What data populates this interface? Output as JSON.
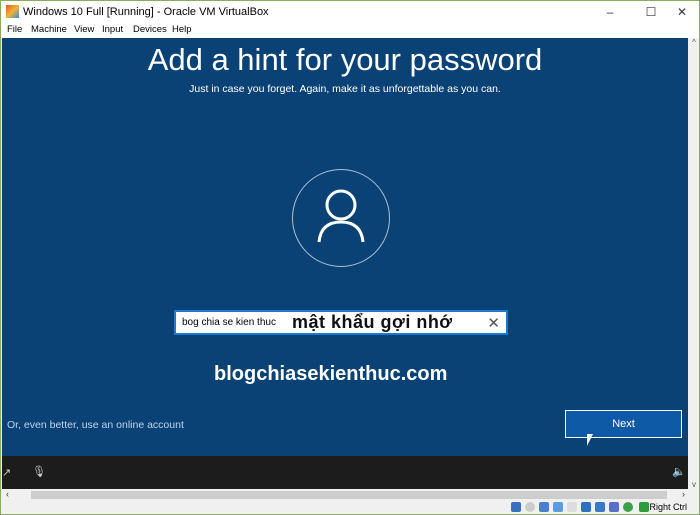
{
  "window": {
    "title": "Windows 10 Full [Running] - Oracle VM VirtualBox",
    "minimize": "–",
    "maximize": "☐",
    "close": "✕"
  },
  "menu": [
    "File",
    "Machine",
    "View",
    "Input",
    "Devices",
    "Help"
  ],
  "setup": {
    "heading": "Add a hint for your password",
    "subtitle": "Just in case you forget. Again, make it as unforgettable as you can.",
    "hint_value": "bog chia se kien thuc",
    "overlay_caption": "mật khẩu gợi nhớ",
    "clear_icon": "✕",
    "watermark": "blogchiasekienthuc.com",
    "online_link": "Or, even better, use an online account",
    "next_label": "Next",
    "accent": "#0b4275"
  },
  "status": {
    "host_key": "Right Ctrl",
    "icons": [
      "hard-disk",
      "optical-drive",
      "network",
      "usb",
      "shared-folders",
      "display",
      "video-capture",
      "virtualization",
      "mouse-integration",
      "keyboard"
    ]
  }
}
